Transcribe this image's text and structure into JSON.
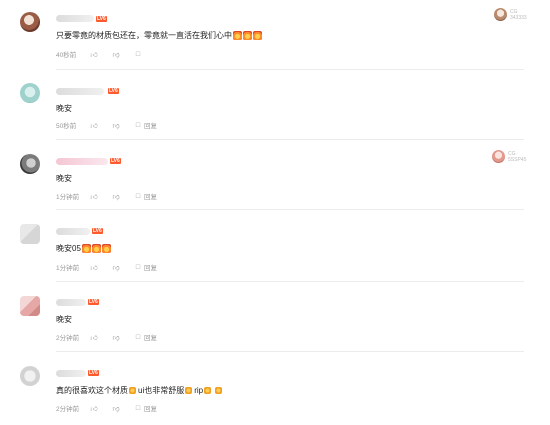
{
  "comments": [
    {
      "text": "只要零竟的材质包还在，零竟就一直活在我们心中",
      "time": "40秒前",
      "reply": "",
      "emoji_count": 3,
      "pinned_text": "CG\n343333"
    },
    {
      "text": "晚安",
      "time": "50秒前",
      "reply": "回复"
    },
    {
      "text": "晚安",
      "time": "1分钟前",
      "reply": "回复",
      "pinned_text": "CG\n5SSP45"
    },
    {
      "text": "晚安05",
      "time": "1分钟前",
      "reply": "回复",
      "emoji_count": 3
    },
    {
      "text": "晚安",
      "time": "2分钟前",
      "reply": "回复"
    },
    {
      "text": "真的很喜欢这个材质",
      "text_b": "ui也非常舒服",
      "text_c": "rip",
      "time": "2分钟前",
      "reply": "回复"
    }
  ],
  "badge": "LV6",
  "icons": {
    "like": "thumbs-up-icon",
    "dislike": "thumbs-down-icon",
    "reply": "reply-icon"
  }
}
